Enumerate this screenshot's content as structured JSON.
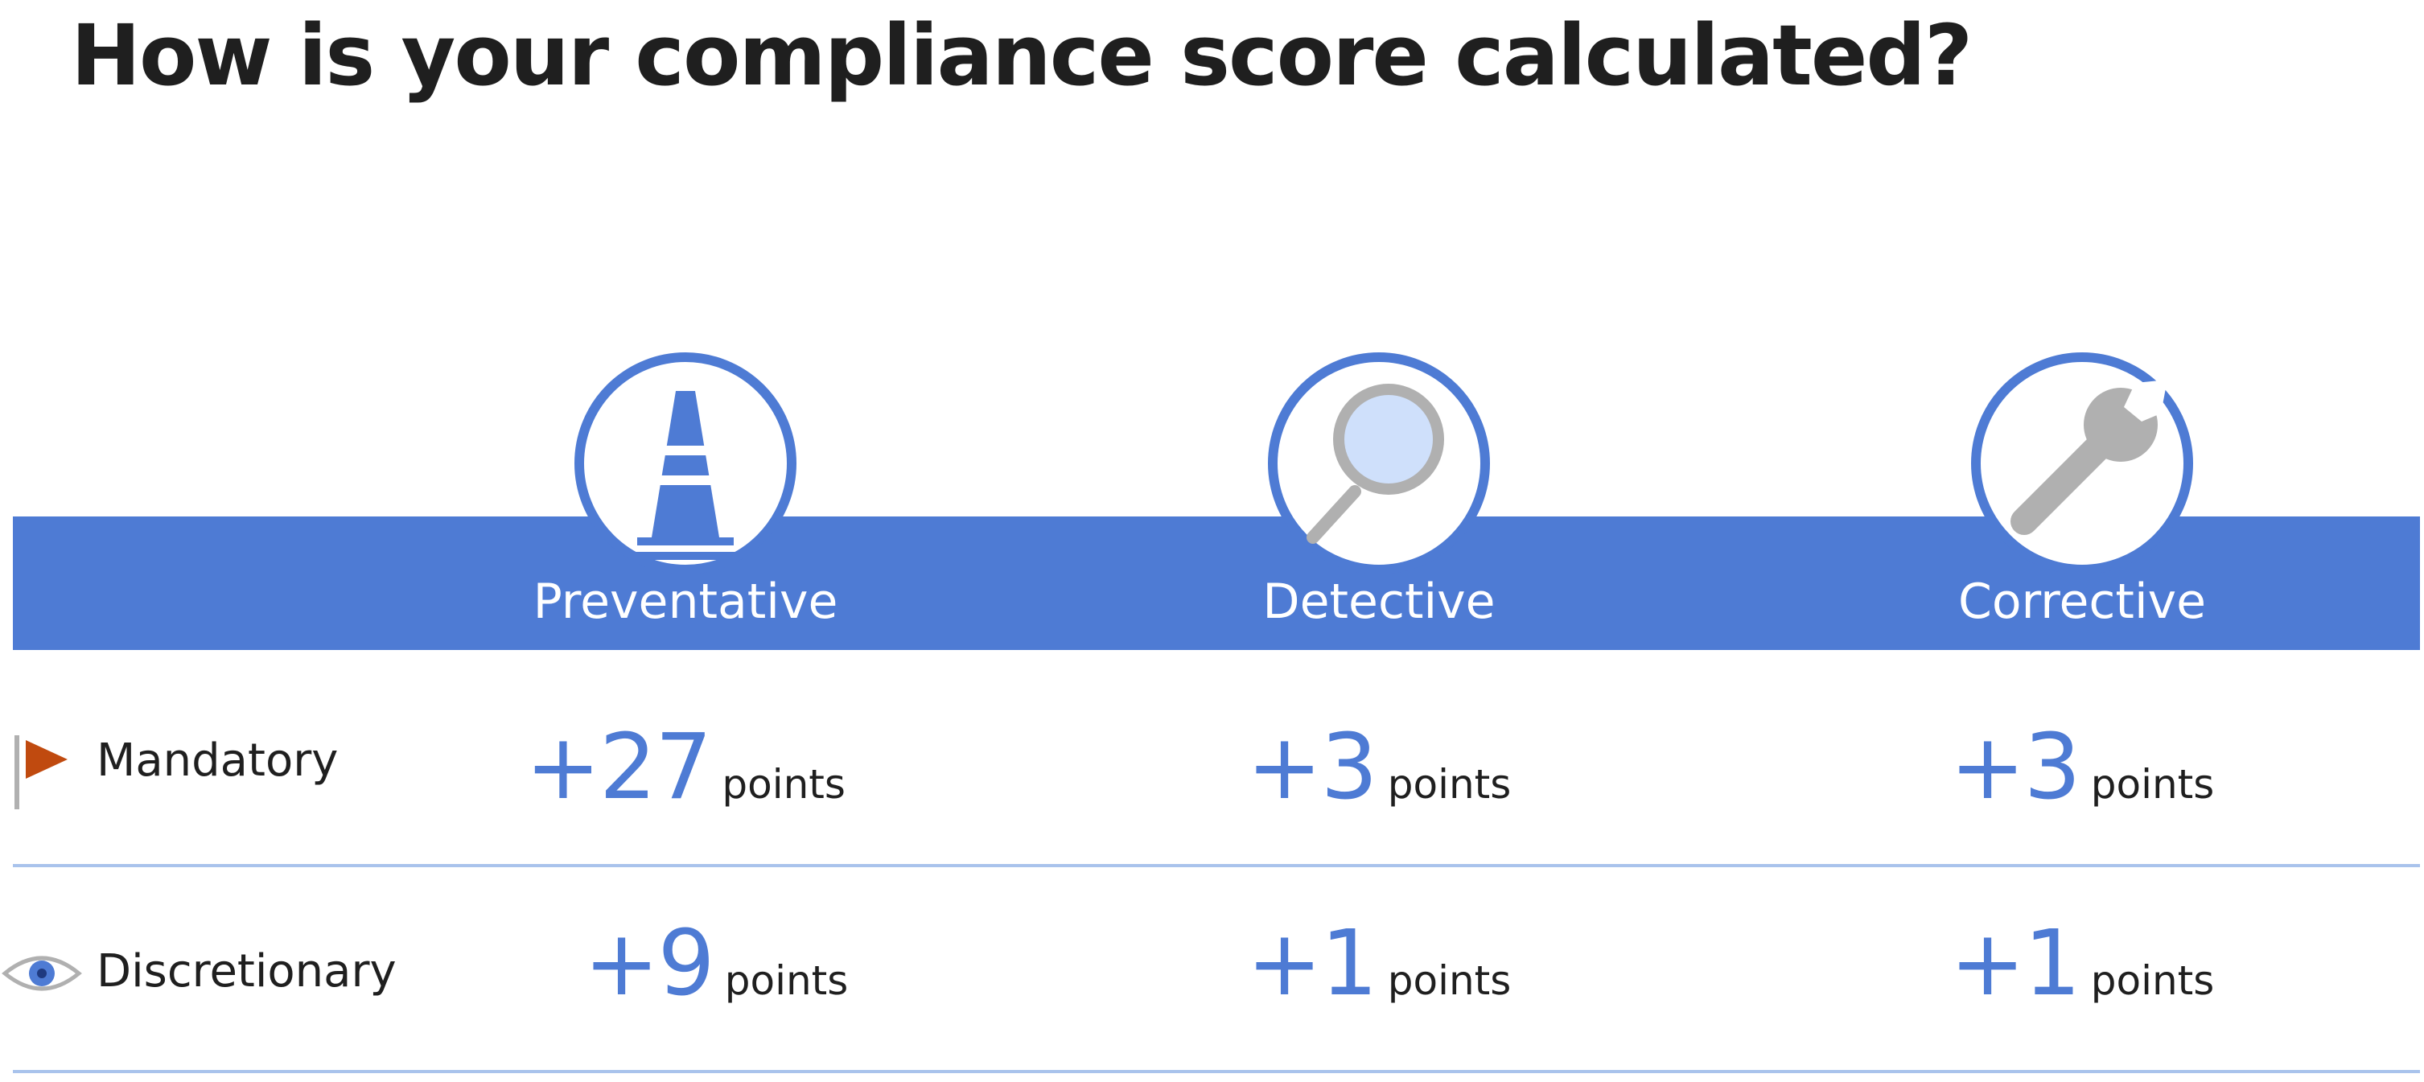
{
  "title": "How is your compliance score calculated?",
  "colors": {
    "accent": "#4e7bd4",
    "divider": "#a9c3ec",
    "flag": "#c04a0f",
    "icon_gray": "#b0b0b0",
    "lens": "#cfe0fb"
  },
  "columns": [
    {
      "label": "Preventative",
      "icon": "traffic-cone-icon"
    },
    {
      "label": "Detective",
      "icon": "magnifier-icon"
    },
    {
      "label": "Corrective",
      "icon": "wrench-icon"
    }
  ],
  "rows": [
    {
      "label": "Mandatory",
      "icon": "flag-icon",
      "cells": [
        {
          "value": "+27",
          "unit": "points"
        },
        {
          "value": "+3",
          "unit": "points"
        },
        {
          "value": "+3",
          "unit": "points"
        }
      ]
    },
    {
      "label": "Discretionary",
      "icon": "eye-icon",
      "cells": [
        {
          "value": "+9",
          "unit": "points"
        },
        {
          "value": "+1",
          "unit": "points"
        },
        {
          "value": "+1",
          "unit": "points"
        }
      ]
    }
  ]
}
